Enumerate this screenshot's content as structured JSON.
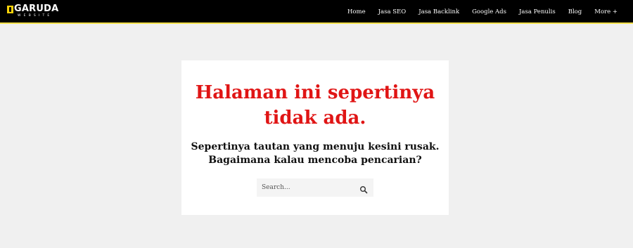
{
  "header": {
    "logo": {
      "main": "GARUDA",
      "sub": "WEBSITE"
    },
    "nav": [
      {
        "label": "Home"
      },
      {
        "label": "Jasa SEO"
      },
      {
        "label": "Jasa Backlink"
      },
      {
        "label": "Google Ads"
      },
      {
        "label": "Jasa Penulis"
      },
      {
        "label": "Blog"
      },
      {
        "label": "More +"
      }
    ]
  },
  "main": {
    "title": "Halaman ini sepertinya tidak ada.",
    "subtitle": "Sepertinya tautan yang menuju kesini rusak. Bagaimana kalau mencoba pencarian?",
    "search": {
      "placeholder": "Search...",
      "value": "",
      "icon": "search-icon"
    }
  },
  "colors": {
    "header_bg": "#000000",
    "header_border": "#f5e14a",
    "title": "#e01515",
    "page_bg": "#f0f0f0",
    "logo_accent": "#f6d10a"
  }
}
